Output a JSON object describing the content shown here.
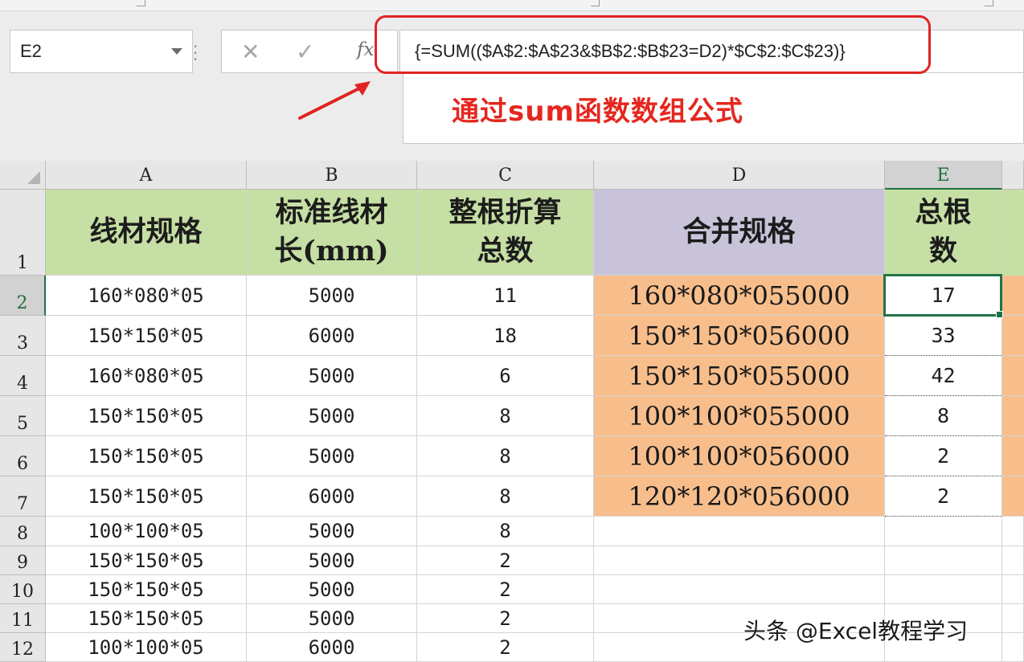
{
  "formula_bar": {
    "name_box": "E2",
    "formula": "{=SUM(($A$2:$A$23&$B$2:$B$23=D2)*$C$2:$C$23)}",
    "fx_label": "fx",
    "cancel_glyph": "✕",
    "enter_glyph": "✓"
  },
  "annotation": "通过sum函数数组公式",
  "columns": [
    "A",
    "B",
    "C",
    "D",
    "E"
  ],
  "selected_cell": "E2",
  "header_row": {
    "row_number": "1",
    "a": "线材规格",
    "b_line1": "标准线材",
    "b_line2": "长(mm)",
    "c_line1": "整根折算",
    "c_line2": "总数",
    "d": "合并规格",
    "e_line1": "总根",
    "e_line2": "数"
  },
  "rows": [
    {
      "row": "2",
      "a": "160*080*05",
      "b": "5000",
      "c": "11",
      "d": "160*080*055000",
      "e": "17"
    },
    {
      "row": "3",
      "a": "150*150*05",
      "b": "6000",
      "c": "18",
      "d": "150*150*056000",
      "e": "33"
    },
    {
      "row": "4",
      "a": "160*080*05",
      "b": "5000",
      "c": "6",
      "d": "150*150*055000",
      "e": "42"
    },
    {
      "row": "5",
      "a": "150*150*05",
      "b": "5000",
      "c": "8",
      "d": "100*100*055000",
      "e": "8"
    },
    {
      "row": "6",
      "a": "150*150*05",
      "b": "5000",
      "c": "8",
      "d": "100*100*056000",
      "e": "2"
    },
    {
      "row": "7",
      "a": "150*150*05",
      "b": "6000",
      "c": "8",
      "d": "120*120*056000",
      "e": "2"
    },
    {
      "row": "8",
      "a": "100*100*05",
      "b": "5000",
      "c": "8",
      "d": "",
      "e": ""
    },
    {
      "row": "9",
      "a": "150*150*05",
      "b": "5000",
      "c": "2",
      "d": "",
      "e": ""
    },
    {
      "row": "10",
      "a": "150*150*05",
      "b": "5000",
      "c": "2",
      "d": "",
      "e": ""
    },
    {
      "row": "11",
      "a": "150*150*05",
      "b": "5000",
      "c": "2",
      "d": "",
      "e": ""
    },
    {
      "row": "12",
      "a": "100*100*05",
      "b": "6000",
      "c": "2",
      "d": "",
      "e": ""
    }
  ],
  "watermark": "头条 @Excel教程学习",
  "colors": {
    "green_header": "#c6dfa4",
    "purple_header": "#c9c3da",
    "orange_fill": "#f7be8c",
    "selection": "#217346",
    "highlight_red": "#e02424"
  }
}
